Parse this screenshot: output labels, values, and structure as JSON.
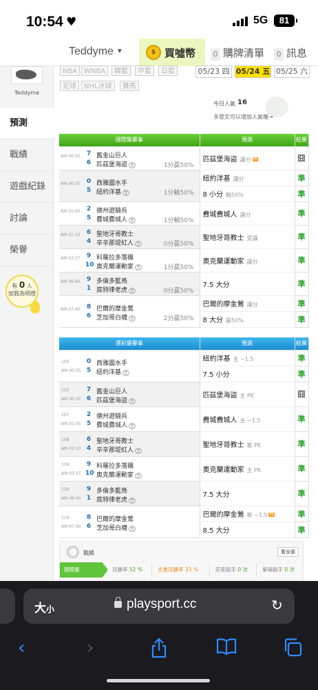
{
  "status": {
    "time": "10:54",
    "network": "5G",
    "battery": "81"
  },
  "topnav": {
    "user": "Teddyme",
    "coin_label": "買噓幣",
    "coin_icon_text": "$",
    "items": [
      {
        "count": "0",
        "label": "購牌清單"
      },
      {
        "count": "0",
        "label": "訊息"
      }
    ]
  },
  "sidebar": {
    "username": "Teddyme",
    "items": [
      "預測",
      "戰績",
      "遊戲紀錄",
      "討論",
      "榮譽"
    ],
    "promo": {
      "line1": "有",
      "count": "0",
      "unit": "人",
      "line2": "加我為明燈"
    }
  },
  "filters": {
    "sports": [
      "NBA",
      "WNBA",
      "韓籃",
      "中籃",
      "日籃",
      "足球",
      "NHL冰球",
      "賽馬"
    ],
    "dates": [
      {
        "label": "05/23 四"
      },
      {
        "label": "05/24 五"
      },
      {
        "label": "05/25 六"
      }
    ]
  },
  "popularity": {
    "label": "今日人氣",
    "value": "16",
    "tip": "多發文可以增加人氣喔→"
  },
  "intl_table": {
    "headers": [
      "國際盤賽事",
      "預測",
      "結果"
    ],
    "games": [
      {
        "time": "AM 00:35",
        "s1": "7",
        "t1": "舊金山巨人",
        "s2": "6",
        "t2": "匹茲堡海盜",
        "odds": "1分贏50%",
        "picks": [
          {
            "text": "匹茲堡海盜",
            "sub": "讓分",
            "badge": "PK",
            "result": "囧"
          }
        ]
      },
      {
        "time": "AM 00:35",
        "s1": "0",
        "t1": "西雅圖水手",
        "s2": "5",
        "t2": "紐約洋基",
        "odds": "1分輸50%",
        "picks": [
          {
            "text": "紐約洋基",
            "sub": "讓分",
            "result": "準"
          },
          {
            "text": "8 小分",
            "sub": "輸50%",
            "result": "準"
          }
        ]
      },
      {
        "time": "AM 01:05",
        "s1": "2",
        "t1": "德州遊騎兵",
        "s2": "5",
        "t2": "費城費城人",
        "odds": "1分輸50%",
        "picks": [
          {
            "text": "費城費城人",
            "sub": "讓分",
            "result": "準"
          }
        ]
      },
      {
        "time": "AM 01:10",
        "s1": "6",
        "t1": "聖地牙哥教士",
        "s2": "4",
        "t2": "辛辛那堤紅人",
        "odds": "0分贏50%",
        "picks": [
          {
            "text": "聖地牙哥教士",
            "sub": "受讓",
            "result": "準"
          }
        ]
      },
      {
        "time": "AM 03:37",
        "s1": "9",
        "t1": "科羅拉多落磯",
        "s2": "10",
        "t2": "奧克蘭運動家",
        "odds": "1分贏50%",
        "picks": [
          {
            "text": "奧克蘭運動家",
            "sub": "讓分",
            "result": "準"
          }
        ]
      },
      {
        "time": "AM 06:40",
        "s1": "9",
        "t1": "多倫多藍鳥",
        "s2": "1",
        "t2": "底特律老虎",
        "odds": "0分贏50%",
        "picks": [
          {
            "text": "7.5 大分",
            "sub": "",
            "result": "準"
          }
        ]
      },
      {
        "time": "AM 07:40",
        "s1": "8",
        "t1": "巴爾的摩金鶯",
        "s2": "6",
        "t2": "芝加哥白襪",
        "odds": "2分贏50%",
        "picks": [
          {
            "text": "巴爾的摩金鶯",
            "sub": "讓分",
            "result": "準"
          },
          {
            "text": "8 大分",
            "sub": "贏50%",
            "result": "準"
          }
        ]
      }
    ]
  },
  "lottery_table": {
    "headers": [
      "運彩盤賽事",
      "預測",
      "結果"
    ],
    "games": [
      {
        "num": "106",
        "time": "AM 00:35",
        "s1": "0",
        "t1": "西雅圖水手",
        "s2": "5",
        "t2": "紐約洋基",
        "picks": [
          {
            "text": "紐約洋基",
            "sub": "主 −1.5",
            "result": "準"
          },
          {
            "text": "7.5 小分",
            "sub": "",
            "result": "準"
          }
        ]
      },
      {
        "num": "122",
        "time": "AM 00:35",
        "s1": "7",
        "t1": "舊金山巨人",
        "s2": "6",
        "t2": "匹茲堡海盜",
        "picks": [
          {
            "text": "匹茲堡海盜",
            "sub": "主 PK",
            "result": "囧"
          }
        ]
      },
      {
        "num": "107",
        "time": "AM 01:05",
        "s1": "2",
        "t1": "德州遊騎兵",
        "s2": "5",
        "t2": "費城費城人",
        "picks": [
          {
            "text": "費城費城人",
            "sub": "主 −1.5",
            "result": "準"
          }
        ]
      },
      {
        "num": "108",
        "time": "AM 01:10",
        "s1": "6",
        "t1": "聖地牙哥教士",
        "s2": "4",
        "t2": "辛辛那堤紅人",
        "picks": [
          {
            "text": "聖地牙哥教士",
            "sub": "客 PK",
            "result": "準"
          }
        ]
      },
      {
        "num": "109",
        "time": "AM 03:37",
        "s1": "9",
        "t1": "科羅拉多落磯",
        "s2": "10",
        "t2": "奧克蘭運動家",
        "picks": [
          {
            "text": "奧克蘭運動家",
            "sub": "主 PK",
            "result": "準"
          }
        ]
      },
      {
        "num": "120",
        "time": "AM 06:40",
        "s1": "9",
        "t1": "多倫多藍鳥",
        "s2": "1",
        "t2": "底特律老虎",
        "picks": [
          {
            "text": "7.5 大分",
            "sub": "",
            "result": "準"
          }
        ]
      },
      {
        "num": "119",
        "time": "AM 07:40",
        "s1": "8",
        "t1": "巴爾的摩金鶯",
        "s2": "6",
        "t2": "芝加哥白襪",
        "picks": [
          {
            "text": "巴爾的摩金鶯",
            "sub": "客 −1.5",
            "badge": "PK",
            "result": "準"
          },
          {
            "text": "8.5 大分",
            "sub": "",
            "result": "準"
          }
        ]
      }
    ]
  },
  "stats": {
    "title": "戰績",
    "all_btn": "看全部",
    "cells": [
      {
        "label": "國際盤",
        "value": ""
      },
      {
        "label": "月勝率",
        "value": "52 %"
      },
      {
        "label": "主推月勝率",
        "value": "33 %"
      },
      {
        "label": "莊家殺手",
        "value": "0 次"
      },
      {
        "label": "單場殺手",
        "value": "0 次"
      }
    ]
  },
  "safari": {
    "aa_big": "大",
    "aa_small": "小",
    "url": "playsport.cc"
  },
  "colors": {
    "accent_green": "#3ea514",
    "result_green": "#2aa12a",
    "table_blue": "#1b8ed3",
    "active_date": "#ffe200",
    "ios_blue": "#2f8cff"
  }
}
